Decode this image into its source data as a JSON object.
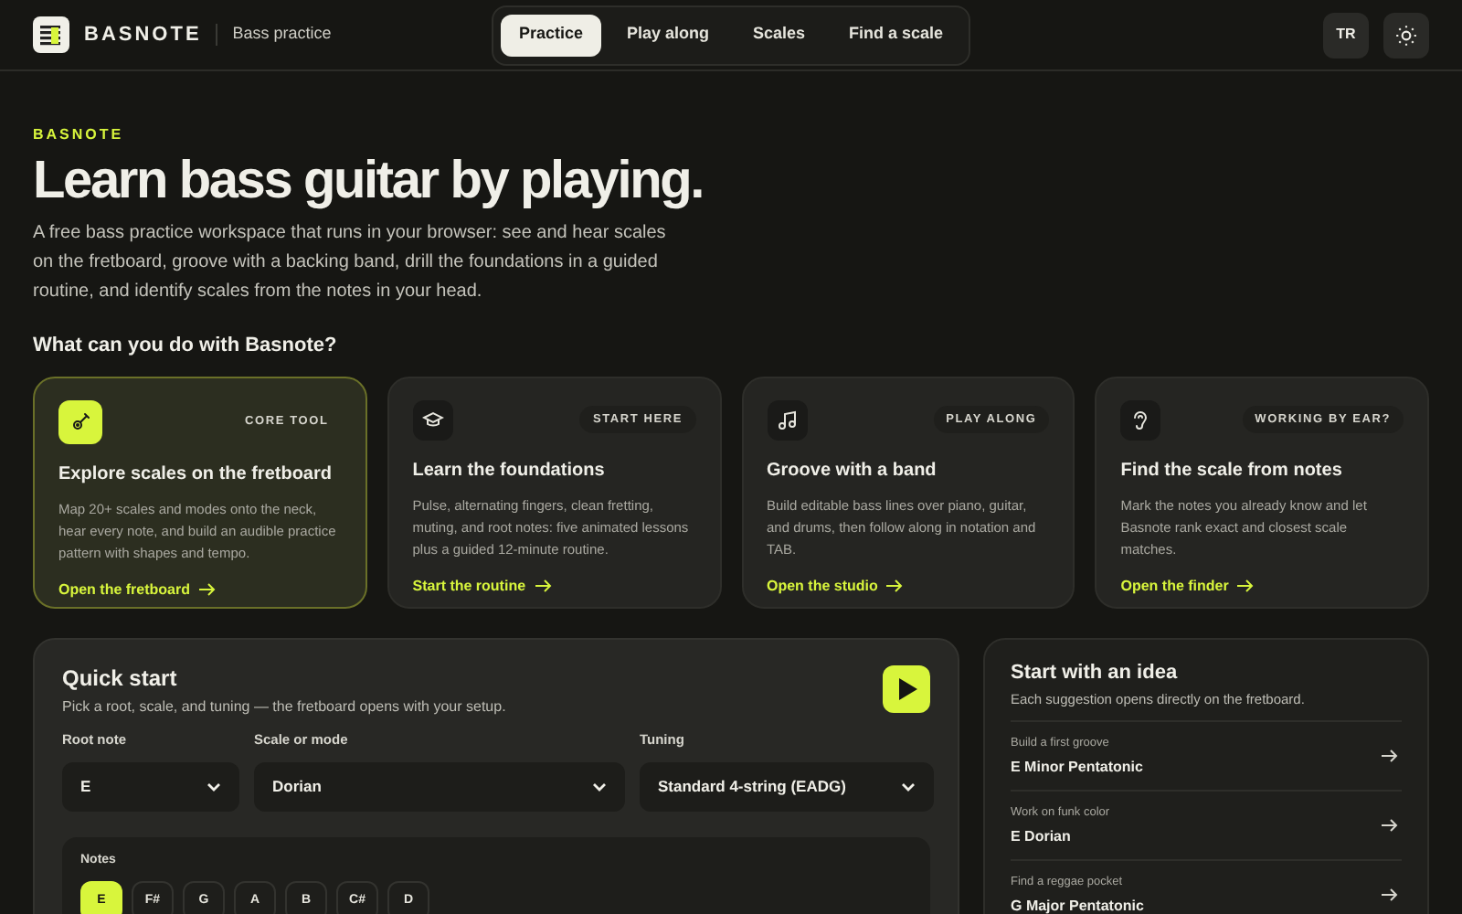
{
  "header": {
    "brand": "BASNOTE",
    "subtitle": "Bass practice",
    "nav": [
      {
        "label": "Practice",
        "selected": true
      },
      {
        "label": "Play along",
        "selected": false
      },
      {
        "label": "Scales",
        "selected": false
      },
      {
        "label": "Find a scale",
        "selected": false
      }
    ],
    "language": "TR"
  },
  "hero": {
    "eyebrow": "BASNOTE",
    "title": "Learn bass guitar by playing.",
    "description": "A free bass practice workspace that runs in your browser: see and hear scales on the fretboard, groove with a backing band, drill the foundations in a guided routine, and identify scales from the notes in your head.",
    "question": "What can you do with Basnote?"
  },
  "cards": [
    {
      "badge": "CORE TOOL",
      "title": "Explore scales on the fretboard",
      "text": "Map 20+ scales and modes onto the neck, hear every note, and build an audible practice pattern with shapes and tempo.",
      "link": "Open the fretboard",
      "selected": true
    },
    {
      "badge": "START HERE",
      "title": "Learn the foundations",
      "text": "Pulse, alternating fingers, clean fretting, muting, and root notes: five animated lessons plus a guided 12-minute routine.",
      "link": "Start the routine",
      "selected": false
    },
    {
      "badge": "PLAY ALONG",
      "title": "Groove with a band",
      "text": "Build editable bass lines over piano, guitar, and drums, then follow along in notation and TAB.",
      "link": "Open the studio",
      "selected": false
    },
    {
      "badge": "WORKING BY EAR?",
      "title": "Find the scale from notes",
      "text": "Mark the notes you already know and let Basnote rank exact and closest scale matches.",
      "link": "Open the finder",
      "selected": false
    }
  ],
  "quick_start": {
    "title": "Quick start",
    "subtitle": "Pick a root, scale, and tuning — the fretboard opens with your setup.",
    "fields": [
      {
        "label": "Root note",
        "value": "E"
      },
      {
        "label": "Scale or mode",
        "value": "Dorian"
      },
      {
        "label": "Tuning",
        "value": "Standard 4-string (EADG)"
      }
    ],
    "notes_label": "Notes",
    "notes": [
      {
        "label": "E",
        "selected": true
      },
      {
        "label": "F#",
        "selected": false
      },
      {
        "label": "G",
        "selected": false
      },
      {
        "label": "A",
        "selected": false
      },
      {
        "label": "B",
        "selected": false
      },
      {
        "label": "C#",
        "selected": false
      },
      {
        "label": "D",
        "selected": false
      }
    ]
  },
  "ideas": {
    "title": "Start with an idea",
    "subtitle": "Each suggestion opens directly on the fretboard.",
    "items": [
      {
        "caption": "Build a first groove",
        "title": "E Minor Pentatonic"
      },
      {
        "caption": "Work on funk color",
        "title": "E Dorian"
      },
      {
        "caption": "Find a reggae pocket",
        "title": "G Major Pentatonic"
      }
    ]
  }
}
